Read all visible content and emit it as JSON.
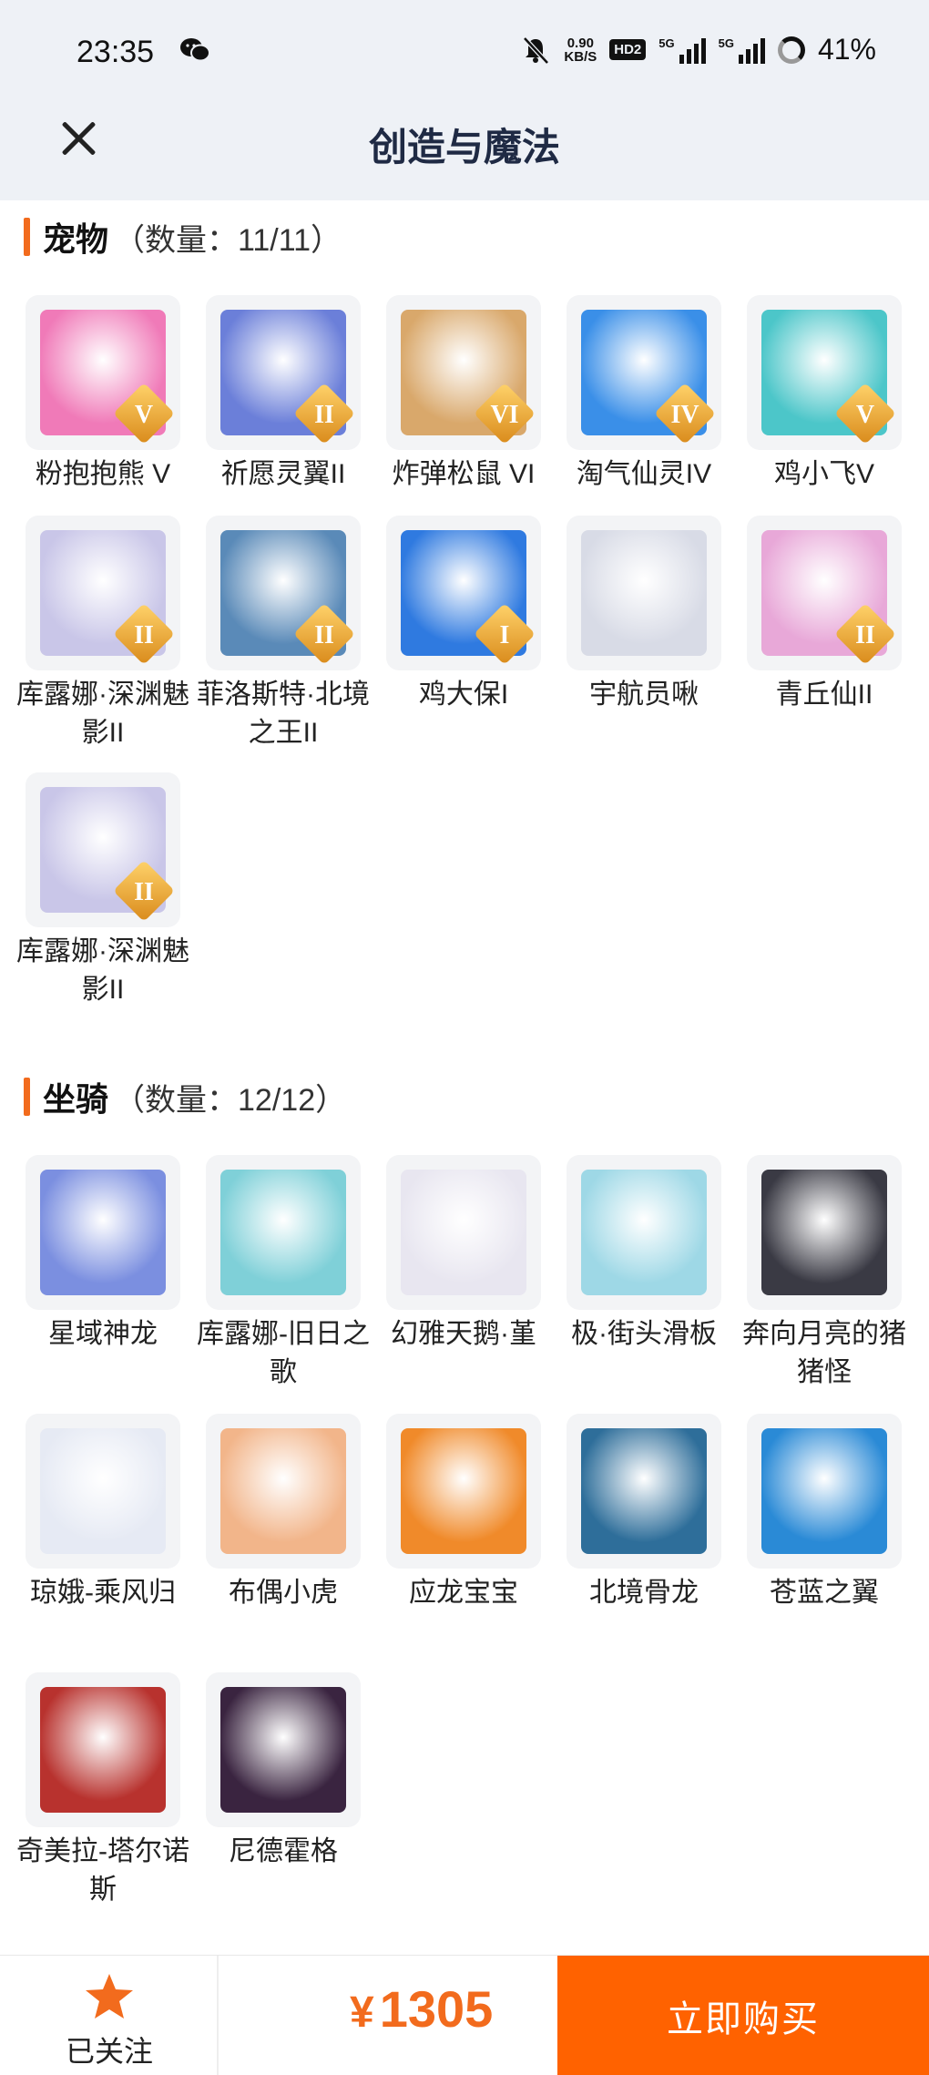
{
  "status": {
    "time": "23:35",
    "net_speed_value": "0.90",
    "net_speed_unit": "KB/S",
    "hd_label": "HD2",
    "sim1_label": "5G",
    "sim2_label": "5G",
    "battery": "41%"
  },
  "nav": {
    "title": "创造与魔法"
  },
  "pets": {
    "name": "宠物",
    "count": "（数量：11/11）",
    "items": [
      {
        "name": "粉抱抱熊 V",
        "tier": "V",
        "color": "#f07ab8"
      },
      {
        "name": "祈愿灵翼II",
        "tier": "II",
        "color": "#6b7fd9"
      },
      {
        "name": "炸弹松鼠 VI",
        "tier": "VI",
        "color": "#d9a86b"
      },
      {
        "name": "淘气仙灵IV",
        "tier": "IV",
        "color": "#3a8fe8"
      },
      {
        "name": "鸡小飞V",
        "tier": "V",
        "color": "#4cc6c9"
      },
      {
        "name": "库露娜·深渊魅影II",
        "tier": "II",
        "color": "#c9c6e8"
      },
      {
        "name": "菲洛斯特·北境之王II",
        "tier": "II",
        "color": "#5a8ab8"
      },
      {
        "name": "鸡大保I",
        "tier": "I",
        "color": "#2f7ae0"
      },
      {
        "name": "宇航员啾",
        "tier": "",
        "color": "#d8dbe6"
      },
      {
        "name": "青丘仙II",
        "tier": "II",
        "color": "#e8a8d8"
      },
      {
        "name": "库露娜·深渊魅影II",
        "tier": "II",
        "color": "#c9c6e8"
      }
    ]
  },
  "mounts": {
    "name": "坐骑",
    "count": "（数量：12/12）",
    "items": [
      {
        "name": "星域神龙",
        "color": "#7b8fe0"
      },
      {
        "name": "库露娜-旧日之歌",
        "color": "#7fd0d8"
      },
      {
        "name": "幻雅天鹅·堇",
        "color": "#e8e6f0"
      },
      {
        "name": "极·街头滑板",
        "color": "#9ed8e6"
      },
      {
        "name": "奔向月亮的猪猪怪",
        "color": "#3a3a44"
      },
      {
        "name": "琼娥-乘风归",
        "color": "#e6eaf4"
      },
      {
        "name": "布偶小虎",
        "color": "#f2b58a"
      },
      {
        "name": "应龙宝宝",
        "color": "#f08a2a"
      },
      {
        "name": "北境骨龙",
        "color": "#2e6e9a"
      },
      {
        "name": "苍蓝之翼",
        "color": "#2a8ad6"
      },
      {
        "name": "奇美拉-塔尔诺斯",
        "color": "#b8322e"
      },
      {
        "name": "尼德霍格",
        "color": "#3a2440"
      }
    ]
  },
  "bottom": {
    "follow_label": "已关注",
    "currency": "¥",
    "price": "1305",
    "buy_label": "立即购买"
  },
  "colors": {
    "accent": "#f26b1d",
    "buy": "#ff6200",
    "header_bg": "#eef1f6"
  },
  "icons": {
    "close": "close-icon",
    "star": "star-icon",
    "wechat": "wechat-icon"
  }
}
